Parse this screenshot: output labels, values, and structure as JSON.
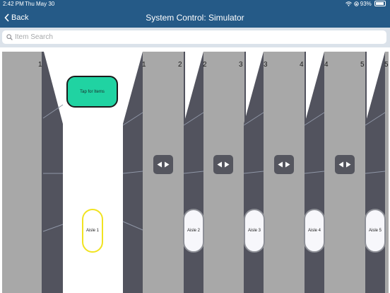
{
  "status_bar": {
    "time": "2:42 PM",
    "date": "Thu May 30",
    "battery": "93%",
    "battery_level": 0.93
  },
  "nav": {
    "back_label": "Back",
    "title": "System Control: Simulator"
  },
  "search": {
    "placeholder": "Item Search",
    "value": ""
  },
  "simulator": {
    "tap_button_label": "Tap for Items",
    "aisles": [
      {
        "label": "Aisle 1",
        "left_number": "1",
        "right_number": "1",
        "selected": true
      },
      {
        "label": "Aisle 2",
        "left_number": "2",
        "right_number": "2",
        "selected": false
      },
      {
        "label": "Aisle 3",
        "left_number": "3",
        "right_number": "3",
        "selected": false
      },
      {
        "label": "Aisle 4",
        "left_number": "4",
        "right_number": "4",
        "selected": false
      },
      {
        "label": "Aisle 5",
        "left_number": "5",
        "right_number": "5",
        "selected": false
      }
    ]
  },
  "colors": {
    "nav_background": "#255a87",
    "search_area_background": "#dbe2ea",
    "rack_light": "#a8a8a8",
    "rack_dark": "#52535e",
    "tap_button": "#20d3a2",
    "selected_aisle_border": "#f1e321"
  }
}
